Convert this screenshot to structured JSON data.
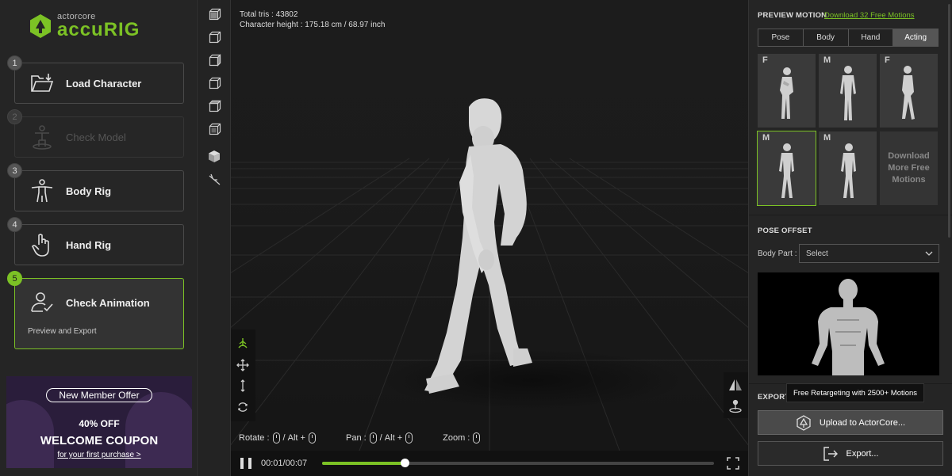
{
  "logo": {
    "small": "actorcore",
    "big": "accuRIG"
  },
  "steps": [
    {
      "num": "1",
      "label": "Load Character"
    },
    {
      "num": "2",
      "label": "Check Model"
    },
    {
      "num": "3",
      "label": "Body Rig"
    },
    {
      "num": "4",
      "label": "Hand Rig"
    },
    {
      "num": "5",
      "label": "Check Animation",
      "sub": "Preview and Export"
    }
  ],
  "promo": {
    "offer": "New Member Offer",
    "percent": "40% OFF",
    "coupon": "WELCOME COUPON",
    "first": "for your first purchase >"
  },
  "viewport": {
    "tris": "Total tris : 43802",
    "height": "Character height : 175.18 cm / 68.97 inch",
    "hints": {
      "rotate": "Rotate :",
      "pan": "Pan :",
      "zoom": "Zoom :",
      "slash": "/",
      "alt": "Alt +"
    }
  },
  "timeline": {
    "time": "00:01/00:07",
    "progress": 0.21
  },
  "preview_motion": {
    "title": "PREVIEW MOTION",
    "download_link": "Download 32 Free Motions",
    "tabs": [
      "Pose",
      "Body",
      "Hand",
      "Acting"
    ],
    "selected_tab": "Acting",
    "thumbs": [
      {
        "gender": "F"
      },
      {
        "gender": "M"
      },
      {
        "gender": "F"
      },
      {
        "gender": "M"
      },
      {
        "gender": "M"
      }
    ],
    "more": "Download More Free Motions"
  },
  "pose_offset": {
    "title": "POSE OFFSET",
    "body_part_label": "Body Part :",
    "select_value": "Select"
  },
  "export": {
    "title": "EXPORT",
    "tooltip": "Free Retargeting with 2500+ Motions",
    "upload_label": "Upload to ActorCore...",
    "export_label": "Export..."
  },
  "colors": {
    "accent": "#7cc225",
    "panel": "#252525",
    "viewport": "#1a1a1a"
  }
}
